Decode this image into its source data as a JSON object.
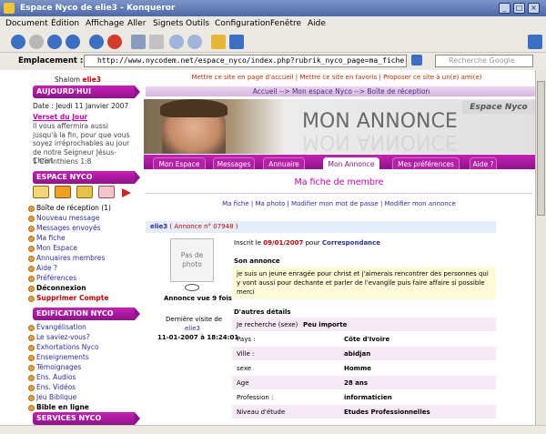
{
  "window": {
    "title": "Espace Nyco de elie3 - Konqueror"
  },
  "menu": [
    "Document",
    "Édition",
    "Affichage",
    "Aller",
    "Signets",
    "Outils",
    "Configuration",
    "Fenêtre",
    "Aide"
  ],
  "location": {
    "label": "Emplacement :",
    "url": "http://www.nycodem.net/espace_nyco/index.php?rubrik_nyco_page=ma_fiche",
    "search_placeholder": "Recherche Google"
  },
  "page": {
    "greeting": "Shalom",
    "username": "elie3",
    "top_links": "Mettre ce site en page d'accueil | Mettre ce site en favoris | Proposer ce site à un(e) ami(e)",
    "breadcrumb": "Accueil --> Mon espace Nyco --> Boîte de réception",
    "banner_title": "MON ANNONCE",
    "banner_brand": "Espace Nyco",
    "tabs": [
      "Mon Espace",
      "Messages",
      "Annuaire",
      "Mon Annonce",
      "Mes préférences",
      "Aide ?"
    ],
    "title": "Ma fiche de membre",
    "links": "Ma fiche | Ma photo | Modifier mon mot de passe | Modifier mon annonce",
    "annonce_header_user": "elie3",
    "annonce_header_num": "( Annonce n° 07948 )",
    "photo_text": "Pas de photo",
    "views": "Annonce vue 9 fois",
    "last_visit_label": "Dernière visite de",
    "last_visit_user": "elie3",
    "last_visit_date": "11-01-2007 à 18:24:01",
    "inscrit": "Inscrit le",
    "inscrit_date": "09/01/2007",
    "inscrit_pour": "pour",
    "inscrit_cat": "Correspondance",
    "son_annonce": "Son annonce",
    "annonce_text": "je suis un jeune enragée pour christ et j'aimerais rencontrer des personnes qui y vont aussi pour dechante et parler de l'evangile puis faire affaire si possible merci",
    "autres_details": "D'autres détails",
    "details": [
      {
        "k": "Je recherche (sexe)",
        "v": "Peu importe"
      },
      {
        "k": "Pays :",
        "v": "Côte d'Ivoire"
      },
      {
        "k": "Ville :",
        "v": "abidjan"
      },
      {
        "k": "sexe",
        "v": "Homme"
      },
      {
        "k": "Age",
        "v": "28 ans"
      },
      {
        "k": "Profession :",
        "v": "informaticien"
      },
      {
        "k": "Niveau d'étude",
        "v": "Etudes Professionnelles"
      }
    ]
  },
  "sidebar": {
    "today_head": "AUJOURD'HUI",
    "date_label": "Date :",
    "date": "Jeudi 11 Janvier 2007",
    "verset_head": "Verset du Jour",
    "verset": "Il vous affermira aussi jusqu'à la fin, pour que vous soyez irréprochables au jour de notre Seigneur Jésus-Christ.",
    "verset_ref": "1 Corinthiens 1:8",
    "espace_head": "ESPACE NYCO",
    "espace_items": [
      "Boîte de réception (1)",
      "Nouveau message",
      "Messages envoyés",
      "Ma fiche",
      "Mon Espace",
      "Annuaires membres",
      "Aide ?",
      "Préférences"
    ],
    "deconnexion": "Déconnexion",
    "supprimer": "Supprimer Compte",
    "edif_head": "EDIFICATION NYCO",
    "edif_items": [
      "Évangélisation",
      "Le saviez-vous?",
      "Exhortations Nyco",
      "Enseignements",
      "Témoignages",
      "Ens. Audios",
      "Ens. Vidéos",
      "Jeu Biblique"
    ],
    "bible": "Bible en ligne",
    "services_head": "SERVICES NYCO"
  }
}
